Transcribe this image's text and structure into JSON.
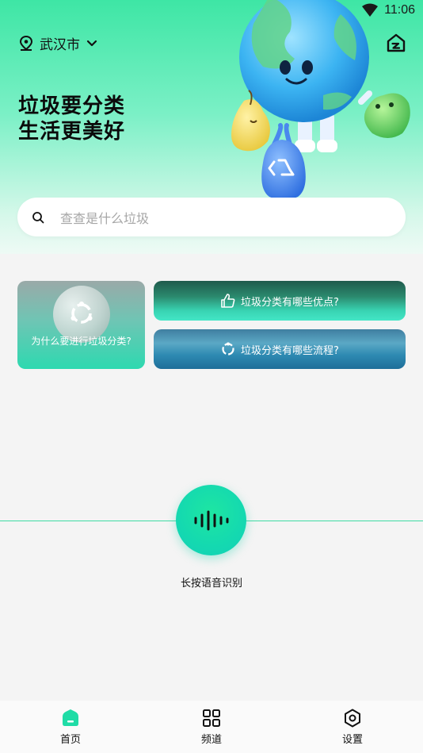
{
  "status_bar": {
    "time": "11:06",
    "wifi_icon": "wifi-icon"
  },
  "header": {
    "city": "武汉市",
    "home_icon": "home-icon"
  },
  "slogan": {
    "line1": "垃圾要分类",
    "line2": "生活更美好"
  },
  "search": {
    "placeholder": "查查是什么垃圾"
  },
  "cards": {
    "why": "为什么要进行垃圾分类?",
    "benefits": "垃圾分类有哪些优点?",
    "process": "垃圾分类有哪些流程?"
  },
  "voice": {
    "label": "长按语音识别"
  },
  "tabs": [
    {
      "label": "首页",
      "icon": "home-tab-icon",
      "active": true
    },
    {
      "label": "频道",
      "icon": "grid-icon",
      "active": false
    },
    {
      "label": "设置",
      "icon": "settings-icon",
      "active": false
    }
  ],
  "colors": {
    "accent": "#1fdca6",
    "active_tab": "#1fdca6"
  }
}
